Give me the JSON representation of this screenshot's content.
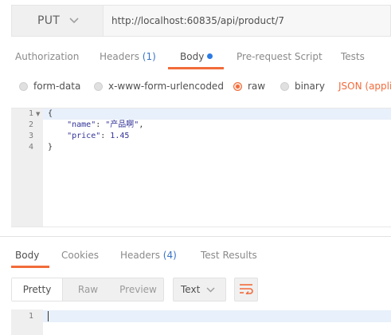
{
  "request": {
    "method": "PUT",
    "url": "http://localhost:60835/api/product/7"
  },
  "request_tabs": {
    "authorization": "Authorization",
    "headers_label": "Headers",
    "headers_count": "(1)",
    "body": "Body",
    "pre_request": "Pre-request Script",
    "tests": "Tests"
  },
  "body_types": {
    "form_data": "form-data",
    "urlencoded": "x-www-form-urlencoded",
    "raw": "raw",
    "binary": "binary",
    "selected": "raw",
    "format": "JSON (applic"
  },
  "editor": {
    "line_numbers": [
      "1",
      "2",
      "3",
      "4"
    ],
    "lines": {
      "l1": "{",
      "l2_key": "\"name\"",
      "l2_sep": ": ",
      "l2_val": "\"产品啊\"",
      "l2_end": ",",
      "l3_key": "\"price\"",
      "l3_sep": ": ",
      "l3_val": "1.45",
      "l4": "}"
    }
  },
  "response_tabs": {
    "body": "Body",
    "cookies": "Cookies",
    "headers_label": "Headers",
    "headers_count": "(4)",
    "test_results": "Test Results"
  },
  "response_view": {
    "pretty": "Pretty",
    "raw": "Raw",
    "preview": "Preview",
    "format": "Text",
    "line_number": "1"
  },
  "colors": {
    "accent": "#f26b3a",
    "link_blue": "#3a73c6"
  }
}
